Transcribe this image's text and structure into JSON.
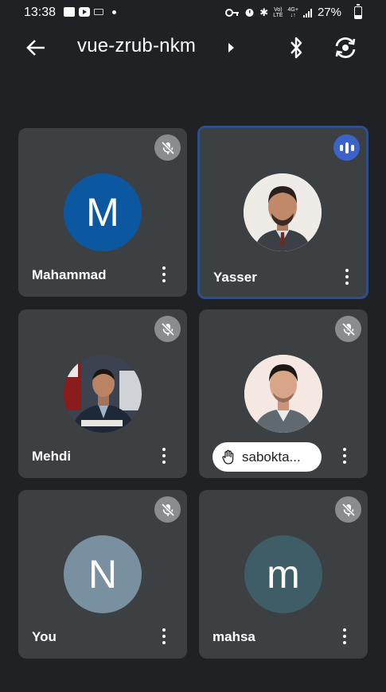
{
  "status_bar": {
    "time": "13:38",
    "battery": "27%",
    "battery_level": 0.27,
    "network_top": "Vo)",
    "network_bottom": "LTE",
    "gen_top": "4G+",
    "gen_bottom": "↓↑",
    "icons_left": [
      "gallery-icon",
      "youtube-icon",
      "app-icon",
      "dot-icon"
    ],
    "icons_right": [
      "key-icon",
      "alarm-icon",
      "bluetooth-icon",
      "signal-icon",
      "battery-icon"
    ]
  },
  "header": {
    "title": "vue-zrub-nkm",
    "icons": [
      "back-arrow-icon",
      "caret-right-icon",
      "bluetooth-icon",
      "switch-camera-icon"
    ]
  },
  "participants": [
    {
      "name": "Mahammad",
      "avatar_letter": "M",
      "avatar_color": "#0b57a0",
      "muted": true,
      "speaking": false,
      "has_photo": false
    },
    {
      "name": "Yasser",
      "avatar_letter": "",
      "avatar_color": "#e8e4de",
      "muted": false,
      "speaking": true,
      "has_photo": true
    },
    {
      "name": "Mehdi",
      "avatar_letter": "",
      "avatar_color": "#2b3540",
      "muted": true,
      "speaking": false,
      "has_photo": true
    },
    {
      "name": "sabokta...",
      "avatar_letter": "",
      "avatar_color": "#f3e6e1",
      "muted": true,
      "speaking": false,
      "has_photo": true,
      "hand_raised": true
    },
    {
      "name": "You",
      "avatar_letter": "N",
      "avatar_color": "#7890a0",
      "muted": true,
      "speaking": false,
      "has_photo": false
    },
    {
      "name": "mahsa",
      "avatar_letter": "m",
      "avatar_color": "#3f5d66",
      "muted": true,
      "speaking": false,
      "has_photo": false
    }
  ],
  "colors": {
    "background": "#202124",
    "tile": "#3c4043",
    "speaking_border": "#2f4f8a",
    "speaking_badge": "#3c63c9",
    "mute_badge": "#8a8d90"
  }
}
